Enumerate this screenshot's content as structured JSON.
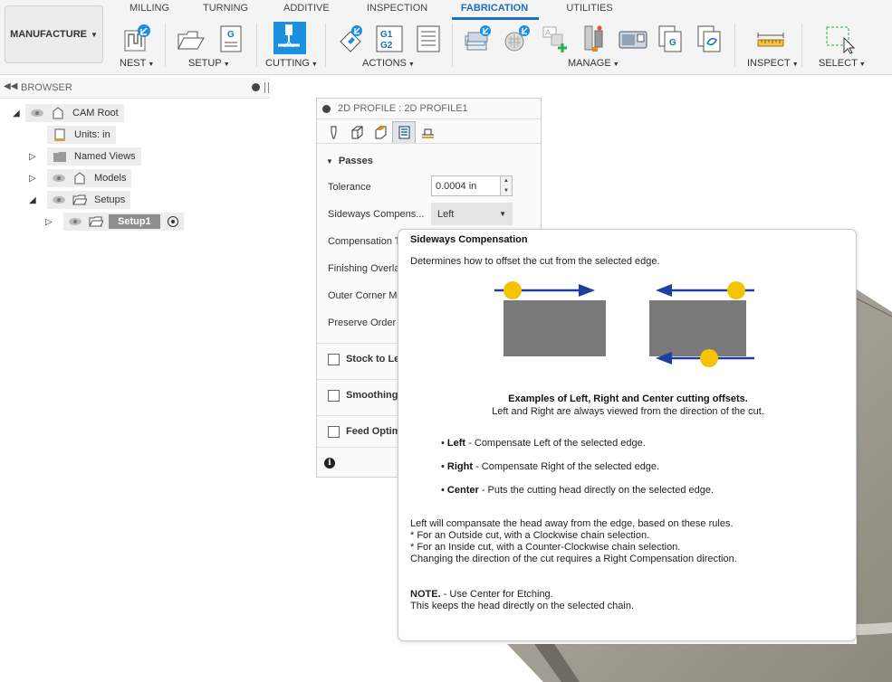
{
  "toolbar": {
    "workspace": "MANUFACTURE",
    "tabs": [
      "MILLING",
      "TURNING",
      "ADDITIVE",
      "INSPECTION",
      "FABRICATION",
      "UTILITIES"
    ],
    "active_tab": "FABRICATION",
    "groups": [
      "NEST",
      "SETUP",
      "CUTTING",
      "ACTIONS",
      "MANAGE",
      "INSPECT",
      "SELECT"
    ],
    "icons": {
      "nest": "nest-icon",
      "setup": [
        "setup-folder-icon",
        "nc-program-icon"
      ],
      "cutting": "2d-profile-cutting-icon",
      "actions": [
        "simulate-icon",
        "post-process-g1g2-icon",
        "setup-sheet-icon"
      ],
      "manage": [
        "tool-library-icon",
        "template-library-icon",
        "add-template-icon",
        "post-library-icon",
        "machine-library-icon",
        "nc-program-library-icon",
        "task-manager-icon"
      ],
      "inspect": "measure-icon",
      "select": "window-select-icon"
    },
    "nc_icon_text": "G",
    "g1g2_text": [
      "G1",
      "G2"
    ]
  },
  "browser": {
    "title": "BROWSER",
    "items": [
      {
        "label": "CAM Root"
      },
      {
        "label": "Units: in"
      },
      {
        "label": "Named Views"
      },
      {
        "label": "Models"
      },
      {
        "label": "Setups"
      },
      {
        "label": "Setup1"
      }
    ]
  },
  "dialog": {
    "title": "2D PROFILE : 2D PROFILE1",
    "tabs": [
      "tool-tab-icon",
      "geometry-tab-icon",
      "heights-tab-icon",
      "passes-tab-icon",
      "linking-tab-icon"
    ],
    "selected_tab": 3,
    "section": "Passes",
    "fields": {
      "tolerance_label": "Tolerance",
      "tolerance_value": "0.0004 in",
      "sideways_label": "Sideways Compens...",
      "sideways_value": "Left",
      "compensation_type_label": "Compensation T",
      "finishing_overlap_label": "Finishing Overla",
      "outer_corner_label": "Outer Corner Mo",
      "preserve_order_label": "Preserve Order"
    },
    "groups": [
      "Stock to Le",
      "Smoothing",
      "Feed Optim"
    ]
  },
  "tooltip": {
    "title": "Sideways Compensation",
    "description": "Determines how to offset the cut from the selected edge.",
    "caption_bold": "Examples of Left, Right and Center cutting offsets.",
    "caption": "Left and Right are always viewed from the direction of the cut.",
    "options": [
      {
        "name": "Left",
        "text": " - Compensate Left of the selected edge."
      },
      {
        "name": "Right",
        "text": " - Compensate Right of the selected edge."
      },
      {
        "name": "Center",
        "text": " - Puts the cutting head directly on the selected edge."
      }
    ],
    "rules": [
      "Left will compansate the head away from the edge, based on these rules.",
      "* For an Outside cut, with a Clockwise chain selection.",
      "* For an Inside cut, with a Counter-Clockwise chain selection.",
      "Changing the direction of the cut requires a Right Compensation direction."
    ],
    "note_label": "NOTE.",
    "note_text": " - Use Center for Etching.",
    "note_detail": "This keeps the head directly on the selected chain.",
    "colors": {
      "arrow": "#1f3f9c",
      "dot": "#f5c400",
      "block": "#7a7a7a"
    }
  },
  "colors": {
    "accent": "#1b6fc1",
    "model_surface": "#9a9488"
  }
}
